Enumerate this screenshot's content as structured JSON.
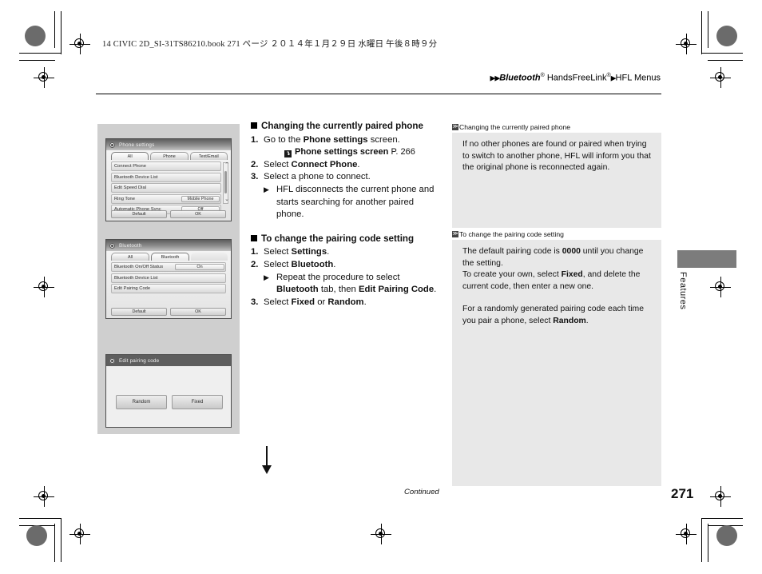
{
  "print_header": {
    "book_line": "14 CIVIC 2D_SI-31TS86210.book   271 ページ   ２０１４年１月２９日   水曜日   午後８時９分"
  },
  "breadcrumb": {
    "arrows": "▶▶",
    "bluetooth": "Bluetooth",
    "reg1": "®",
    "handsfreelink": " HandsFreeLink",
    "reg2": "®",
    "arrow2": "▶",
    "hfl_menus": "HFL Menus"
  },
  "illustrations": {
    "screen1": {
      "title": "Phone settings",
      "tabs": [
        "All",
        "Phone",
        "Text/Email"
      ],
      "selected_tab": "All",
      "rows": [
        {
          "label": "Connect Phone",
          "value": ""
        },
        {
          "label": "Bluetooth Device List",
          "value": ""
        },
        {
          "label": "Edit Speed Dial",
          "value": ""
        },
        {
          "label": "Ring Tone",
          "value": "Mobile Phone"
        },
        {
          "label": "Automatic Phone Sync",
          "value": "Off"
        }
      ],
      "scroll_up": "⌃",
      "scroll_down": "⌄",
      "buttons": [
        "Default",
        "OK"
      ]
    },
    "screen2": {
      "title": "Bluetooth",
      "tabs": [
        "All",
        "Bluetooth",
        ""
      ],
      "selected_tab": "Bluetooth",
      "rows": [
        {
          "label": "Bluetooth On/Off Status",
          "value": "On"
        },
        {
          "label": "Bluetooth Device List",
          "value": ""
        },
        {
          "label": "Edit Pairing Code",
          "value": ""
        }
      ],
      "buttons": [
        "Default",
        "OK"
      ]
    },
    "screen3": {
      "title": "Edit pairing code",
      "buttons": [
        "Random",
        "Fixed"
      ]
    },
    "flow_arrow": "down-arrow"
  },
  "main": {
    "section1": {
      "heading": "Changing the currently paired phone",
      "steps": [
        {
          "num": "1.",
          "parts": [
            {
              "t": "Go to the ",
              "b": false
            },
            {
              "t": "Phone settings",
              "b": true
            },
            {
              "t": " screen.",
              "b": false
            }
          ]
        },
        {
          "num": "2.",
          "parts": [
            {
              "t": "Select ",
              "b": false
            },
            {
              "t": "Connect Phone",
              "b": true
            },
            {
              "t": ".",
              "b": false
            }
          ]
        },
        {
          "num": "3.",
          "parts": [
            {
              "t": "Select a phone to connect.",
              "b": false
            }
          ]
        }
      ],
      "xref_icon": "↴",
      "xref_label": "Phone settings screen",
      "xref_page": "P. 266",
      "step1_text": "Go to the ",
      "step1_bold": "Phone settings",
      "step1_tail": " screen.",
      "step2_text": "Select ",
      "step2_bold": "Connect Phone",
      "step2_tail": ".",
      "step3_text": "Select a phone to connect.",
      "bullet_text": "HFL disconnects the current phone and starts searching for another paired phone."
    },
    "section2": {
      "heading": "To change the pairing code setting",
      "step1_text": "Select ",
      "step1_bold": "Settings",
      "step1_tail": ".",
      "step2_text": "Select ",
      "step2_bold": "Bluetooth",
      "step2_tail": ".",
      "bullet_pre": "Repeat the procedure to select ",
      "bullet_bold1": "Bluetooth",
      "bullet_mid": " tab, then ",
      "bullet_bold2": "Edit Pairing Code",
      "bullet_tail": ".",
      "step3_text": "Select ",
      "step3_bold1": "Fixed",
      "step3_mid": " or ",
      "step3_bold2": "Random",
      "step3_tail": "."
    }
  },
  "notes": {
    "note1": {
      "marker": "≫",
      "label": "Changing the currently paired phone",
      "body": "If no other phones are found or paired when trying to switch to another phone, HFL will inform you that the original phone is reconnected again."
    },
    "note2": {
      "marker": "≫",
      "label": "To change the pairing code setting",
      "p1_a": "The default pairing code is ",
      "p1_b": "0000",
      "p1_c": " until you change the setting.",
      "p2_a": "To create your own, select ",
      "p2_b": "Fixed",
      "p2_c": ", and delete the current code, then enter a new one.",
      "p3_a": "For a randomly generated pairing code each time you pair a phone, select ",
      "p3_b": "Random",
      "p3_c": "."
    }
  },
  "side_tab": {
    "label": "Features",
    "color": "#7c7c7c"
  },
  "footer": {
    "continued": "Continued",
    "page_number": "271"
  }
}
